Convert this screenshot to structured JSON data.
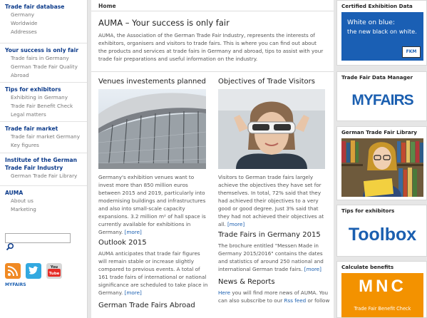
{
  "left_nav": {
    "groups": [
      {
        "head": "Trade fair database",
        "items": [
          "Germany",
          "Worldwide",
          "Addresses"
        ]
      },
      {
        "head": "Your success is only fair",
        "items": [
          "Trade fairs in Germany",
          "German Trade Fair Quality",
          "Abroad"
        ]
      },
      {
        "head": "Tips for exhibitors",
        "items": [
          "Exhibiting in Germany",
          "Trade Fair Benefit Check",
          "Legal matters"
        ]
      },
      {
        "head": "Trade fair market",
        "items": [
          "Trade fair market Germany",
          "Key figures"
        ]
      },
      {
        "head": "Institute of the German Trade Fair Industry",
        "items": [
          "German Trade Fair Library"
        ]
      },
      {
        "head": "AUMA",
        "items": [
          "About us",
          "Marketing"
        ]
      }
    ],
    "search_placeholder": "",
    "logo_text": "MYFAIRS"
  },
  "main": {
    "tab": "Home",
    "intro_title": "AUMA – Your success is only fair",
    "intro_text": "AUMA, the Association of the German Trade Fair Industry, represents the interests of exhibitors, organisers and visitors to trade fairs. This is where you can find out about the products and services at trade fairs in Germany and abroad, tips to assist with your trade fair preparations and useful information on the industry.",
    "more_label": "[more]",
    "left_col": {
      "title": "Venues investements planned",
      "text": "Germany's exhibition venues want to invest more than 850 million euros between 2015 and 2019, particularly into modernising buildings and infrastructures and also into small-scale capacity expansions. 3.2 million m² of hall space is currently available for exhibitions in Germany.",
      "title2": "Outlook 2015",
      "text2": "AUMA anticipates that trade fair figures will remain stable or increase slightly compared to previous events. A total of 161 trade fairs of international or national significance are scheduled to take place in Germany.",
      "title3": "German Trade Fairs Abroad"
    },
    "right_col": {
      "title": "Objectives of Trade Visitors",
      "text": "Visitors to German trade fairs largely achieve the objectives they have set for themselves. In total, 72% said that they had achieved their objectives to a very good or good degree. Just 3% said that they had not achieved their objectives at all.",
      "title2": "Trade Fairs in Germany 2015",
      "text2": "The brochure entitled \"Messen Made in Germany 2015/2016\" contains the dates and statistics of around 250 national and international German trade fairs.",
      "title3": "News & Reports",
      "text3a": "Here",
      "text3b": " you will find more news of AUMA. You can also subscribe to our ",
      "text3c": "Rss feed",
      "text3d": " or follow"
    }
  },
  "right": {
    "boxes": [
      {
        "title": "Certified Exhibition Data",
        "line1": "White on blue:",
        "line2": "the new black on white.",
        "badge": "FKM"
      },
      {
        "title": "Trade Fair Data Manager",
        "logo": "MYFAIRS"
      },
      {
        "title": "German Trade Fair Library"
      },
      {
        "title": "Tips for exhibitors",
        "logo": "Toolbox"
      },
      {
        "title": "Calculate benefits",
        "logo": "MNC",
        "caption": "Trade Fair Benefit Check"
      }
    ]
  },
  "colors": {
    "nav_blue": "#0b3a8a",
    "link_blue": "#1b5fb0",
    "fkm_blue": "#1a5fb4",
    "orange": "#f39200"
  }
}
